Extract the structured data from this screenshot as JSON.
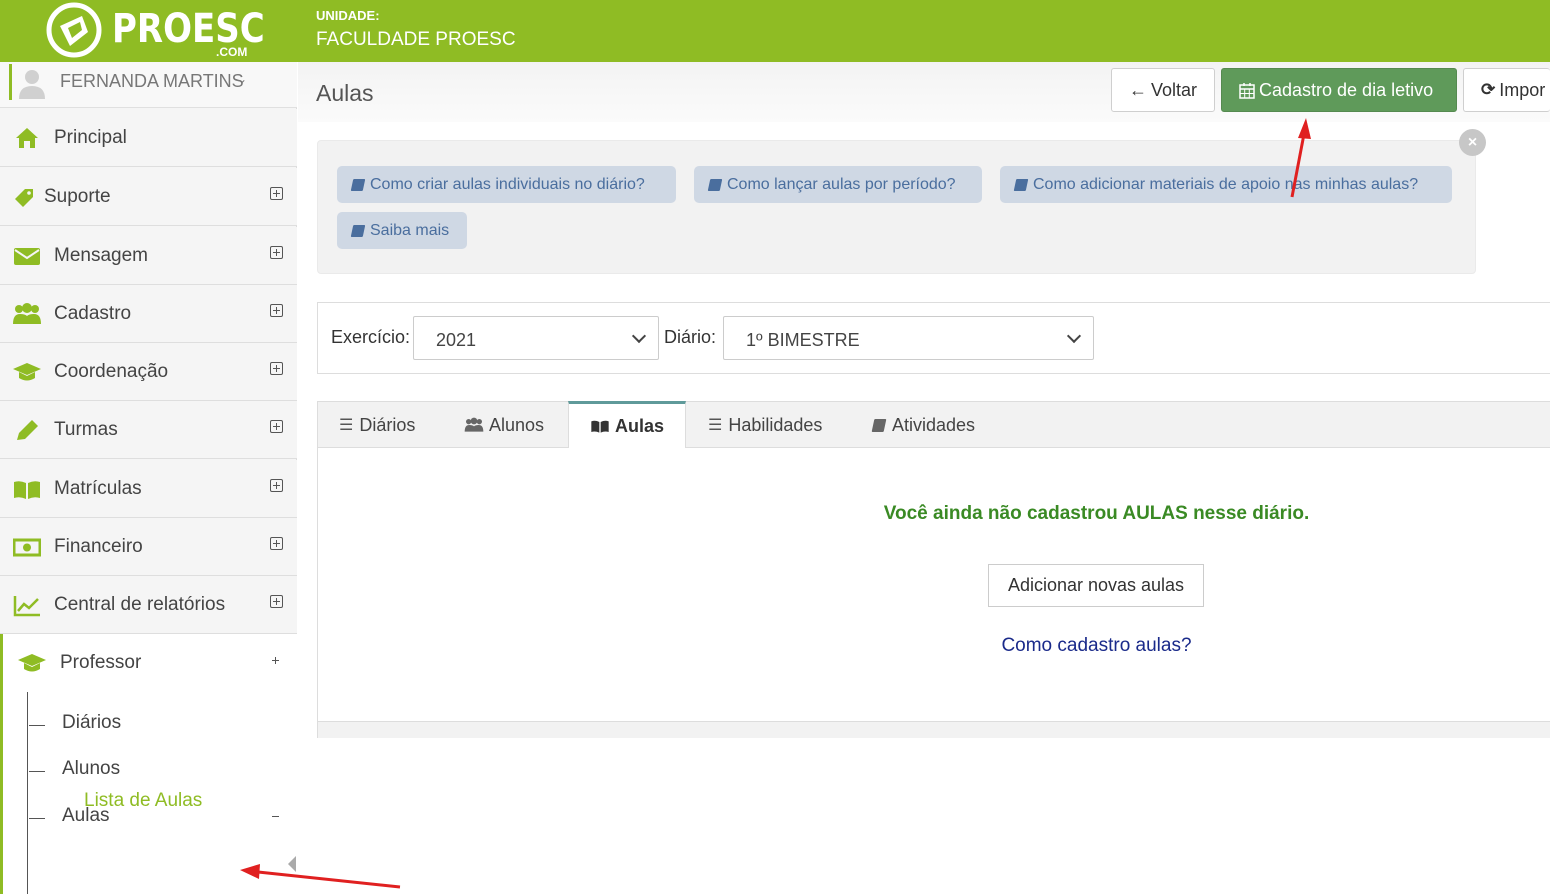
{
  "header": {
    "logo_text": "PROESC",
    "logo_sub": ".COM",
    "unit_label": "UNIDADE:",
    "unit_name": "FACULDADE PROESC",
    "brand_color": "#8fbc24"
  },
  "user": {
    "name": "FERNANDA MARTINS",
    "chevron": "⌄"
  },
  "sidebar": {
    "items": [
      {
        "label": "Principal",
        "icon": "home-icon"
      },
      {
        "label": "Suporte",
        "icon": "tag-icon"
      },
      {
        "label": "Mensagem",
        "icon": "envelope-icon"
      },
      {
        "label": "Cadastro",
        "icon": "users-icon"
      },
      {
        "label": "Coordenação",
        "icon": "graduation-cap-icon"
      },
      {
        "label": "Turmas",
        "icon": "pencil-icon"
      },
      {
        "label": "Matrículas",
        "icon": "book-open-icon"
      },
      {
        "label": "Financeiro",
        "icon": "money-icon"
      },
      {
        "label": "Central de relatórios",
        "icon": "line-chart-icon"
      }
    ],
    "professor": {
      "label": "Professor",
      "icon": "graduation-cap-icon",
      "subitems": [
        "Diários",
        "Alunos",
        "Aulas"
      ],
      "active_subitem": "Lista de Aulas"
    }
  },
  "page": {
    "title": "Aulas",
    "buttons": {
      "back": "Voltar",
      "calendar": "Cadastro de dia letivo",
      "import": "Impor"
    }
  },
  "help": {
    "links": [
      "Como criar aulas individuais no diário?",
      "Como lançar aulas por período?",
      "Como adicionar materiais de apoio nas minhas aulas?",
      "Saiba mais"
    ],
    "close": "×"
  },
  "filters": {
    "exercicio_label": "Exercício:",
    "exercicio_value": "2021",
    "diario_label": "Diário:",
    "diario_value": "1º BIMESTRE"
  },
  "tabs": {
    "items": [
      "Diários",
      "Alunos",
      "Aulas",
      "Habilidades",
      "Atividades"
    ],
    "active": "Aulas"
  },
  "content": {
    "empty_message": "Você ainda não cadastrou AULAS nesse diário.",
    "add_button": "Adicionar novas aulas",
    "help_link": "Como cadastro aulas?"
  },
  "colors": {
    "accent_green": "#8fbc24",
    "button_green": "#5f9a5a",
    "empty_msg_green": "#3a8a24",
    "link_blue": "#1a2a8a",
    "annotation_red": "#e02020"
  }
}
